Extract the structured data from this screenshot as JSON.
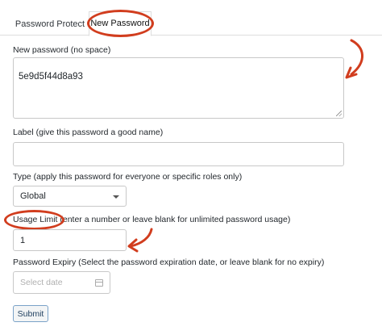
{
  "tabs": [
    {
      "label": "Password Protect"
    },
    {
      "label": "New Password"
    }
  ],
  "form": {
    "new_password_label": "New password (no space)",
    "new_password_value": "5e9d5f44d8a93",
    "label_label": "Label (give this password a good name)",
    "label_value": "",
    "type_label": "Type (apply this password for everyone or specific roles only)",
    "type_value": "Global",
    "usage_limit_label": "Usage Limit (enter a number or leave blank for unlimited password usage)",
    "usage_limit_value": "1",
    "expiry_label": "Password Expiry (Select the password expiration date, or leave blank for no expiry)",
    "expiry_placeholder": "Select date",
    "submit_label": "Submit"
  },
  "icons": {
    "calendar": "calendar-icon",
    "caret": "chevron-down-icon",
    "annotation_arrow": "curved-arrow-icon"
  },
  "colors": {
    "annotation": "#d13d1e",
    "border": "#c8c8c8",
    "submit_border": "#7aa2c8"
  }
}
